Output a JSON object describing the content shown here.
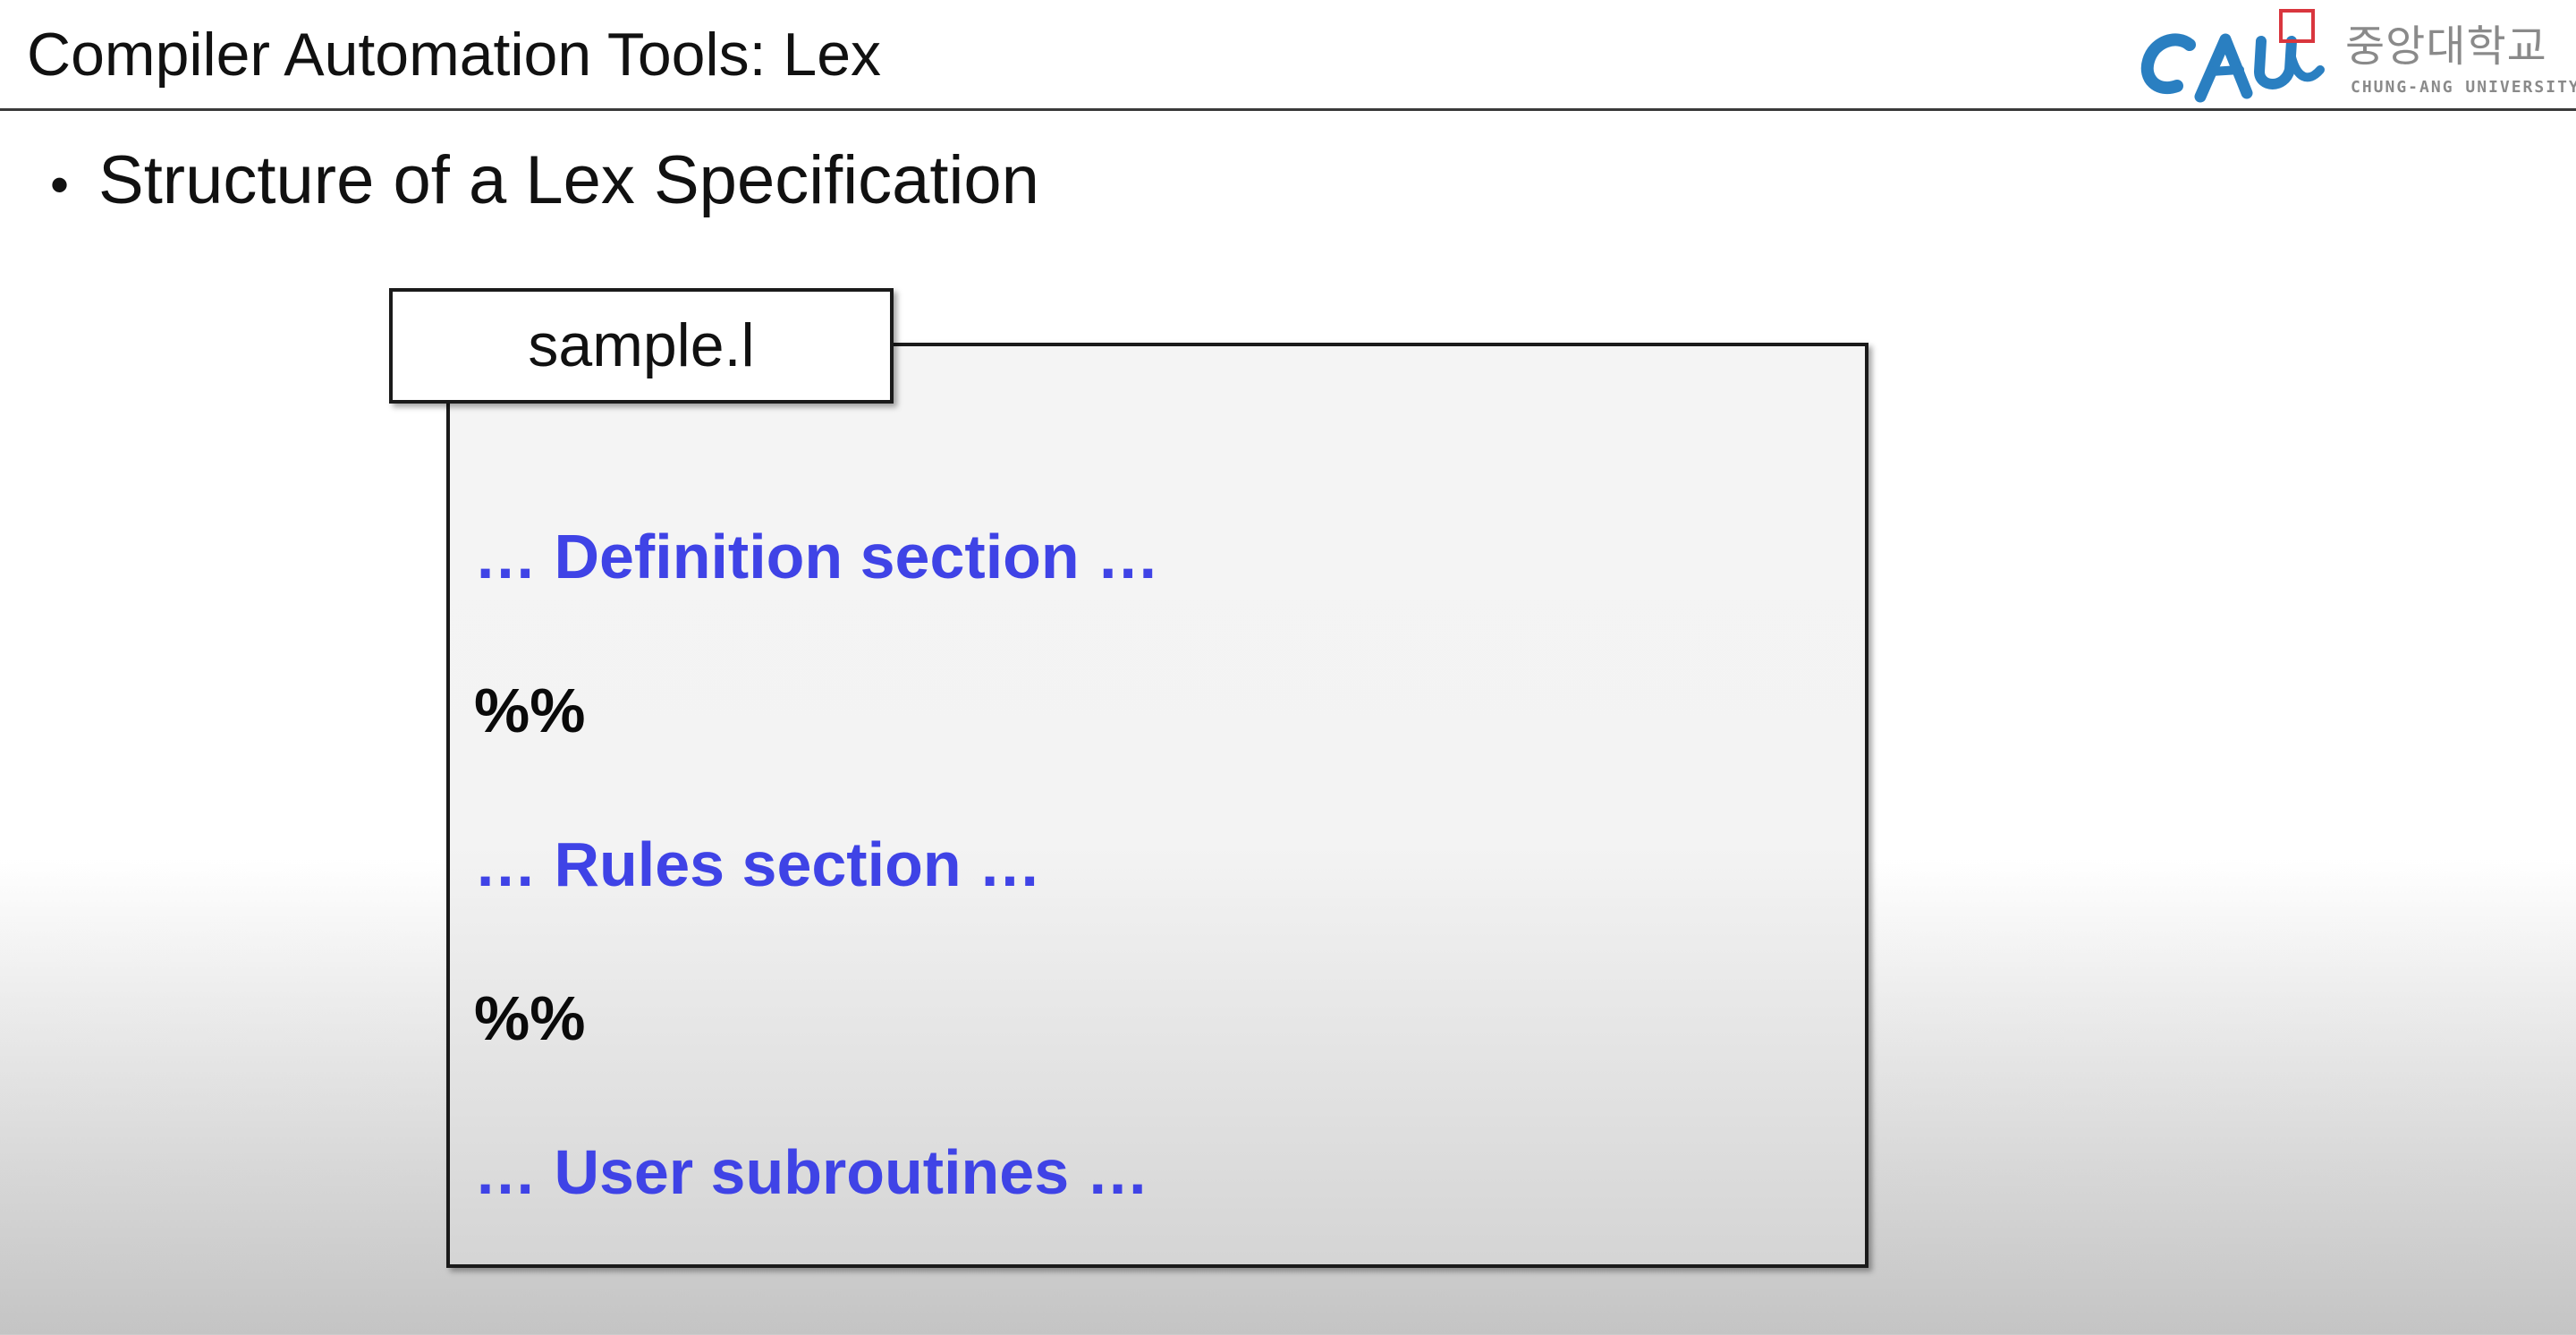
{
  "header": {
    "title": "Compiler Automation Tools: Lex",
    "logo": {
      "mark_text": "CAU",
      "korean_name": "중앙대학교",
      "english_name": "CHUNG-ANG UNIVERSITY",
      "mark_color": "#2a7fc1",
      "accent_color": "#d9363e"
    }
  },
  "slide": {
    "bullet": "Structure of a Lex Specification",
    "file": {
      "name": "sample.l"
    },
    "spec_lines": [
      "… Definition section …",
      "%%",
      "… Rules section …",
      "%%",
      "… User subroutines …"
    ]
  },
  "colors": {
    "section_text": "#3f43e6",
    "separator_text": "#0a0a0a"
  }
}
